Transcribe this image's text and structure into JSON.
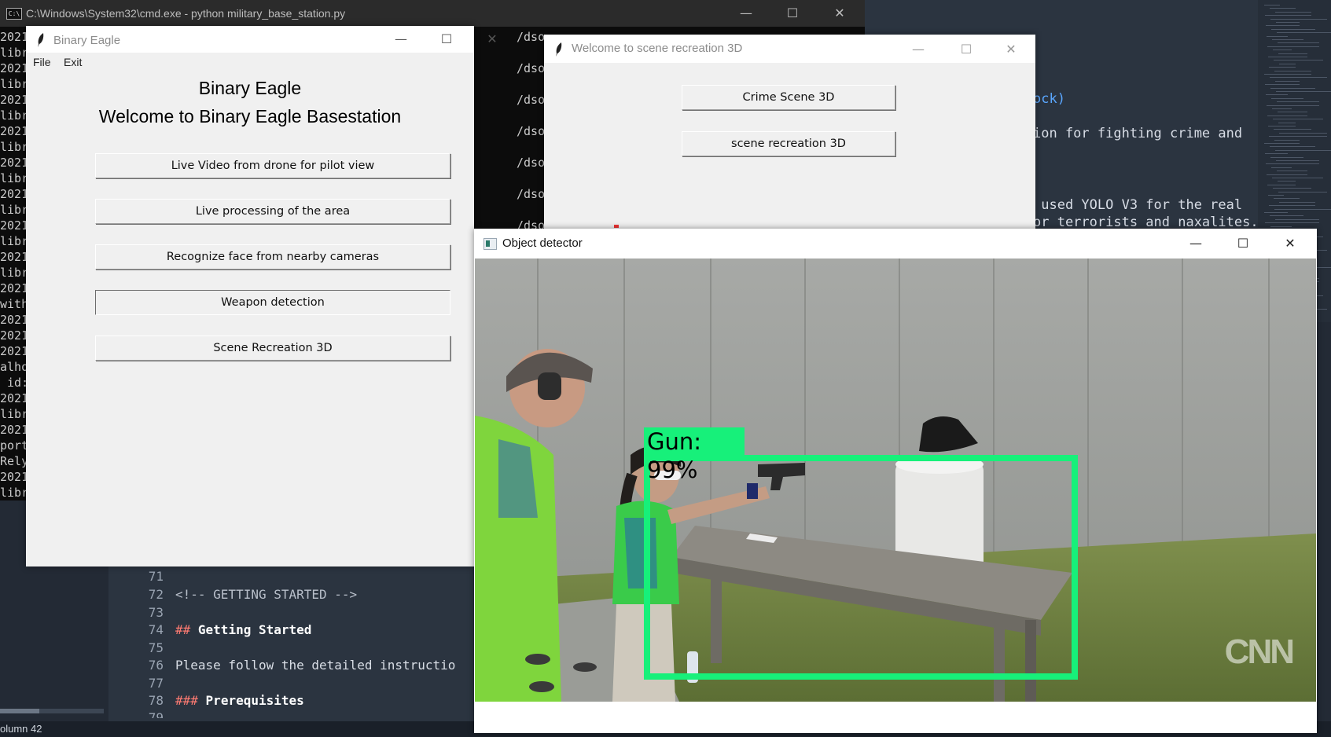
{
  "cmd": {
    "title": "C:\\Windows\\System32\\cmd.exe - python  military_base_station.py",
    "left_lines": [
      "2021",
      "libr",
      "2021",
      "libr",
      "2021",
      "libr",
      "2021",
      "libr",
      "2021",
      "libr",
      "2021",
      "libr",
      "2021",
      "libr",
      "2021",
      "libr",
      "2021",
      "with",
      "2021",
      "2021",
      "2021",
      "alho",
      " id:",
      "2021",
      "libr",
      "2021",
      "port",
      "Rely",
      "2021",
      "libr"
    ],
    "mid_lines": [
      "/dso",
      "/dso",
      "/dso",
      "/dso",
      "/dso",
      "/dso",
      "/dso"
    ]
  },
  "editor": {
    "right_lines": [
      {
        "text": "ock)",
        "link": true
      },
      {
        "text": "ion for fighting crime and",
        "link": false
      },
      {
        "text": " used YOLO V3 for the real",
        "link": false
      },
      {
        "text": "or terrorists and naxalites.",
        "link": false
      }
    ],
    "bottom_lines": [
      {
        "num": "71",
        "text": ""
      },
      {
        "num": "72",
        "text": "<!-- GETTING STARTED -->"
      },
      {
        "num": "73",
        "text": ""
      },
      {
        "num": "74",
        "hash": "##",
        "text": "Getting Started"
      },
      {
        "num": "75",
        "text": ""
      },
      {
        "num": "76",
        "text": "Please follow the detailed instructio"
      },
      {
        "num": "77",
        "text": ""
      },
      {
        "num": "78",
        "hash": "###",
        "text": "Prerequisites"
      },
      {
        "num": "79",
        "text": ""
      }
    ],
    "status": "olumn 42"
  },
  "binary_eagle": {
    "title": "Binary Eagle",
    "menu": [
      "File",
      "Exit"
    ],
    "heading": "Binary Eagle",
    "subheading": "Welcome to Binary Eagle Basestation",
    "buttons": [
      "Live Video from drone for pilot view",
      "Live processing of the area",
      "Recognize face from nearby cameras",
      "Weapon detection",
      "Scene Recreation 3D"
    ]
  },
  "scene_window": {
    "title": "Welcome to scene recreation 3D",
    "buttons": [
      "Crime Scene 3D",
      "scene recreation 3D"
    ]
  },
  "object_detector": {
    "title": "Object detector",
    "detection_label": "Gun: 99%",
    "watermark": "CNN",
    "box_color": "#17f07a"
  },
  "window_controls": {
    "minimize": "—",
    "maximize": "☐",
    "close": "✕"
  }
}
